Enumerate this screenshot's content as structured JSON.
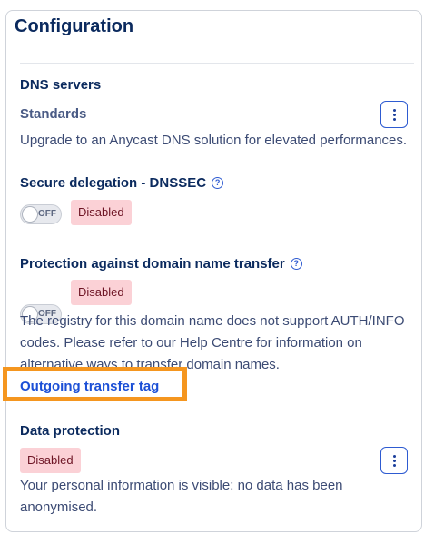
{
  "card": {
    "title": "Configuration"
  },
  "dns": {
    "heading": "DNS servers",
    "type": "Standards",
    "description": "Upgrade to an Anycast DNS solution for elevated performances."
  },
  "dnssec": {
    "heading": "Secure delegation - DNSSEC",
    "help_icon": "?",
    "toggle_label": "OFF",
    "status": "Disabled"
  },
  "transfer_protection": {
    "heading": "Protection against domain name transfer",
    "help_icon": "?",
    "toggle_label": "OFF",
    "status": "Disabled",
    "description": "The registry for this domain name does not support AUTH/INFO codes. Please refer to our Help Centre for information on alternative ways to transfer domain names.",
    "link": "Outgoing transfer tag"
  },
  "data_protection": {
    "heading": "Data protection",
    "status": "Disabled",
    "description": "Your personal information is visible: no data has been anonymised."
  },
  "colors": {
    "highlight": "#f5961f",
    "badge_bg": "#fbd1d6",
    "link": "#1b4fd6"
  }
}
